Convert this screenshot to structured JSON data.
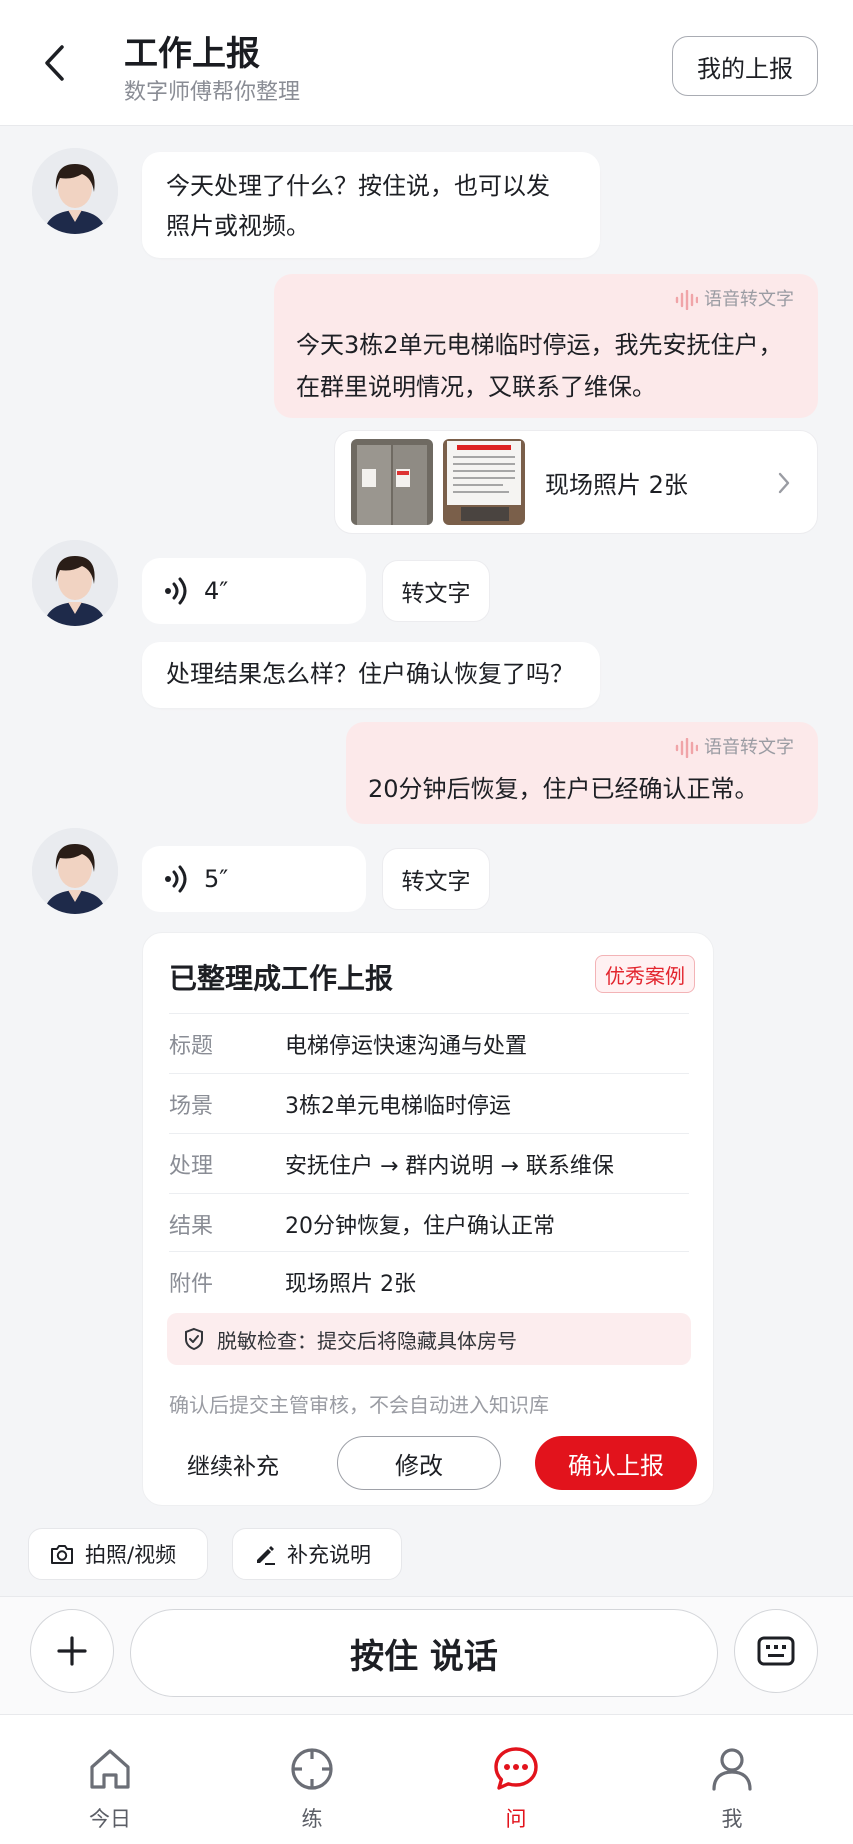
{
  "header": {
    "title": "工作上报",
    "subtitle": "数字师傅帮你整理",
    "my_report_label": "我的上报"
  },
  "messages": {
    "bot_prompt_1": {
      "line1": "今天处理了什么？按住说，也可以发",
      "line2": "照片或视频。"
    },
    "user_voice_1": {
      "tag": "语音转文字",
      "line1": "今天3栋2单元电梯临时停运，我先安抚住户，",
      "line2": "在群里说明情况，又联系了维保。"
    },
    "photos": {
      "label": "现场照片 2张"
    },
    "bot_voice_1": {
      "duration": "4″",
      "to_text": "转文字"
    },
    "bot_prompt_2": {
      "text": "处理结果怎么样？住户确认恢复了吗？"
    },
    "user_voice_2": {
      "tag": "语音转文字",
      "text": "20分钟后恢复，住户已经确认正常。"
    },
    "bot_voice_2": {
      "duration": "5″",
      "to_text": "转文字"
    }
  },
  "report_card": {
    "title": "已整理成工作上报",
    "badge": "优秀案例",
    "rows": [
      {
        "key": "标题",
        "value": "电梯停运快速沟通与处置"
      },
      {
        "key": "场景",
        "value": "3栋2单元电梯临时停运"
      },
      {
        "key": "处理",
        "value": "安抚住户 → 群内说明 → 联系维保"
      },
      {
        "key": "结果",
        "value": "20分钟恢复，住户确认正常"
      },
      {
        "key": "附件",
        "value": "现场照片 2张"
      }
    ],
    "privacy": "脱敏检查：提交后将隐藏具体房号",
    "note": "确认后提交主管审核，不会自动进入知识库",
    "btn_more": "继续补充",
    "btn_edit": "修改",
    "btn_confirm": "确认上报"
  },
  "chips": {
    "photo": "拍照/视频",
    "supplement": "补充说明"
  },
  "input": {
    "hold_label": "按住 说话"
  },
  "tabs": [
    {
      "label": "今日",
      "icon": "home-icon"
    },
    {
      "label": "练",
      "icon": "target-icon"
    },
    {
      "label": "问",
      "icon": "chat-icon"
    },
    {
      "label": "我",
      "icon": "user-icon"
    }
  ],
  "colors": {
    "accent": "#e2131c",
    "user_bubble": "#fce9ea",
    "background": "#f4f5f7"
  }
}
